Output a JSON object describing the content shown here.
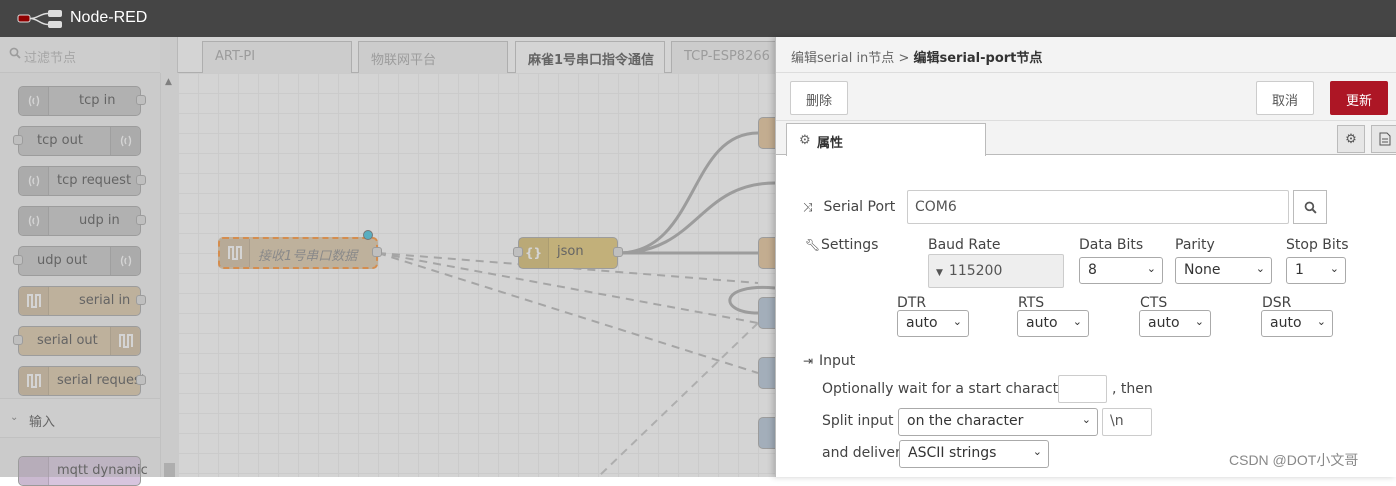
{
  "app": {
    "title": "Node-RED"
  },
  "palette": {
    "filter_placeholder": "过滤节点",
    "nodes": [
      {
        "label": "tcp in",
        "type": "network-in"
      },
      {
        "label": "tcp out",
        "type": "network-out"
      },
      {
        "label": "tcp request",
        "type": "network-in"
      },
      {
        "label": "udp in",
        "type": "network-in"
      },
      {
        "label": "udp out",
        "type": "network-out"
      },
      {
        "label": "serial in",
        "type": "serial-in"
      },
      {
        "label": "serial out",
        "type": "serial-out"
      },
      {
        "label": "serial request",
        "type": "serial-in"
      }
    ],
    "category_label": "输入",
    "next_node": "mqtt dynamic"
  },
  "workspace": {
    "tabs": [
      "ART-PI",
      "物联网平台",
      "麻雀1号串口指令通信",
      "TCP-ESP8266"
    ],
    "active_tab": 2,
    "nodes": {
      "serial_in_label": "接收1号串口数据",
      "json_label": "json"
    }
  },
  "editor": {
    "breadcrumb_parent": "编辑serial in节点",
    "breadcrumb_sep": ">",
    "breadcrumb_current": "编辑serial-port节点",
    "delete_label": "删除",
    "cancel_label": "取消",
    "update_label": "更新",
    "tab_label": "属性",
    "serial_port_label": "Serial Port",
    "serial_port_value": "COM6",
    "settings_label": "Settings",
    "baud_rate_label": "Baud Rate",
    "baud_rate_value": "115200",
    "data_bits_label": "Data Bits",
    "data_bits_value": "8",
    "parity_label": "Parity",
    "parity_value": "None",
    "stop_bits_label": "Stop Bits",
    "stop_bits_value": "1",
    "dtr_label": "DTR",
    "dtr_value": "auto",
    "rts_label": "RTS",
    "rts_value": "auto",
    "cts_label": "CTS",
    "cts_value": "auto",
    "dsr_label": "DSR",
    "dsr_value": "auto",
    "input_label": "Input",
    "wait_label": "Optionally wait for a start character of",
    "wait_value": "",
    "then_label": ", then",
    "split_label": "Split input",
    "split_value": "on the character",
    "split_char": "\\n",
    "deliver_label": "and deliver",
    "deliver_value": "ASCII strings"
  },
  "watermark": "CSDN @DOT小文哥",
  "colors": {
    "header": "#454545",
    "primary": "#ad1625",
    "serial_node": "#d8bf9a",
    "json_node": "#debd5c",
    "network_node": "#c0c0c0",
    "selection": "#ff7f0e"
  },
  "icons": [
    "node-red-logo",
    "search-icon",
    "wifi-icon",
    "serial-icon",
    "json-icon",
    "gear-icon",
    "shuffle-icon",
    "wrench-icon",
    "sign-in-icon",
    "caret-down-icon",
    "description-icon"
  ]
}
